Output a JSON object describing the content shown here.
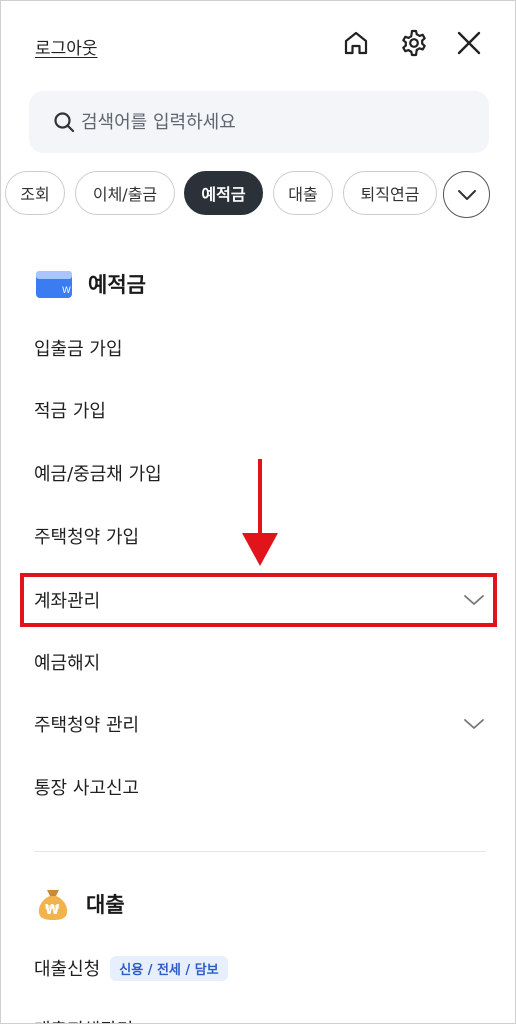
{
  "header": {
    "logout_label": "로그아웃",
    "home_icon": "home-icon",
    "settings_icon": "gear-icon",
    "close_icon": "close-icon"
  },
  "search": {
    "placeholder": "검색어를 입력하세요"
  },
  "tabs": [
    {
      "label": "조회",
      "active": false
    },
    {
      "label": "이체/출금",
      "active": false
    },
    {
      "label": "예적금",
      "active": true
    },
    {
      "label": "대출",
      "active": false
    },
    {
      "label": "퇴직연금",
      "active": false
    }
  ],
  "deposit_section": {
    "title": "예적금",
    "items": [
      {
        "label": "입출금 가입",
        "expandable": false
      },
      {
        "label": "적금 가입",
        "expandable": false
      },
      {
        "label": "예금/중금채 가입",
        "expandable": false
      },
      {
        "label": "주택청약 가입",
        "expandable": false
      },
      {
        "label": "계좌관리",
        "expandable": true
      },
      {
        "label": "예금해지",
        "expandable": false
      },
      {
        "label": "주택청약 관리",
        "expandable": true
      },
      {
        "label": "통장 사고신고",
        "expandable": false
      }
    ]
  },
  "loan_section": {
    "title": "대출",
    "items": [
      {
        "label": "대출신청",
        "badge": "신용 / 전세 / 담보"
      },
      {
        "label": "대출지해관리"
      }
    ]
  },
  "colors": {
    "active_chip": "#2b3138",
    "highlight": "#e0141a",
    "badge_bg": "#e8effc",
    "badge_text": "#2b5cc8"
  }
}
